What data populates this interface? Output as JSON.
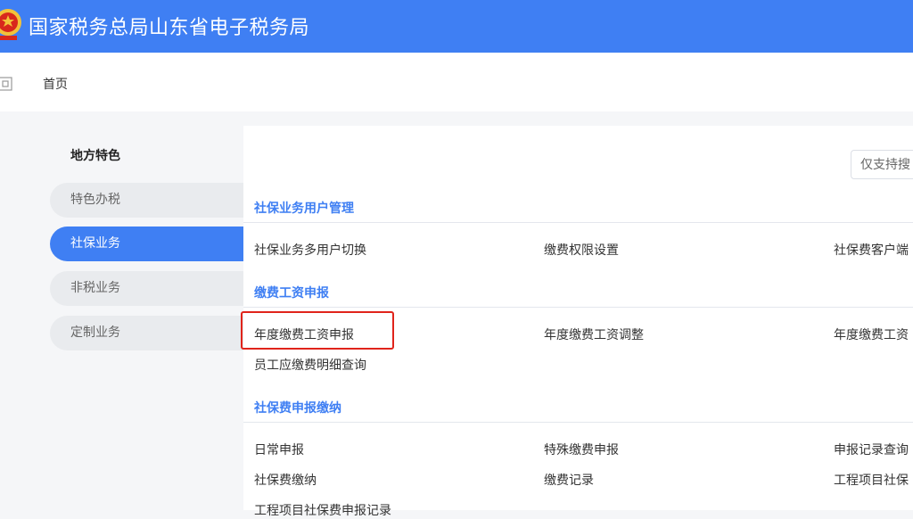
{
  "header": {
    "title": "国家税务总局山东省电子税务局",
    "logo_icon": "tax-emblem-icon",
    "brand_color": "#3f7ff3"
  },
  "breadcrumb": {
    "back_icon": "back-icon",
    "home": "首页"
  },
  "sidebar": {
    "title": "地方特色",
    "items": [
      {
        "label": "特色办税"
      },
      {
        "label": "社保业务",
        "active": true
      },
      {
        "label": "非税业务"
      },
      {
        "label": "定制业务"
      }
    ]
  },
  "search": {
    "placeholder": "仅支持搜"
  },
  "sections": [
    {
      "title": "社保业务用户管理",
      "links": [
        "社保业务多用户切换",
        "缴费权限设置",
        "社保费客户端"
      ]
    },
    {
      "title": "缴费工资申报",
      "links": [
        "年度缴费工资申报",
        "年度缴费工资调整",
        "年度缴费工资",
        "员工应缴费明细查询"
      ]
    },
    {
      "title": "社保费申报缴纳",
      "links": [
        "日常申报",
        "特殊缴费申报",
        "申报记录查询",
        "社保费缴纳",
        "缴费记录",
        "工程项目社保",
        "工程项目社保费申报记录"
      ]
    }
  ],
  "highlight_color": "#e0241b"
}
